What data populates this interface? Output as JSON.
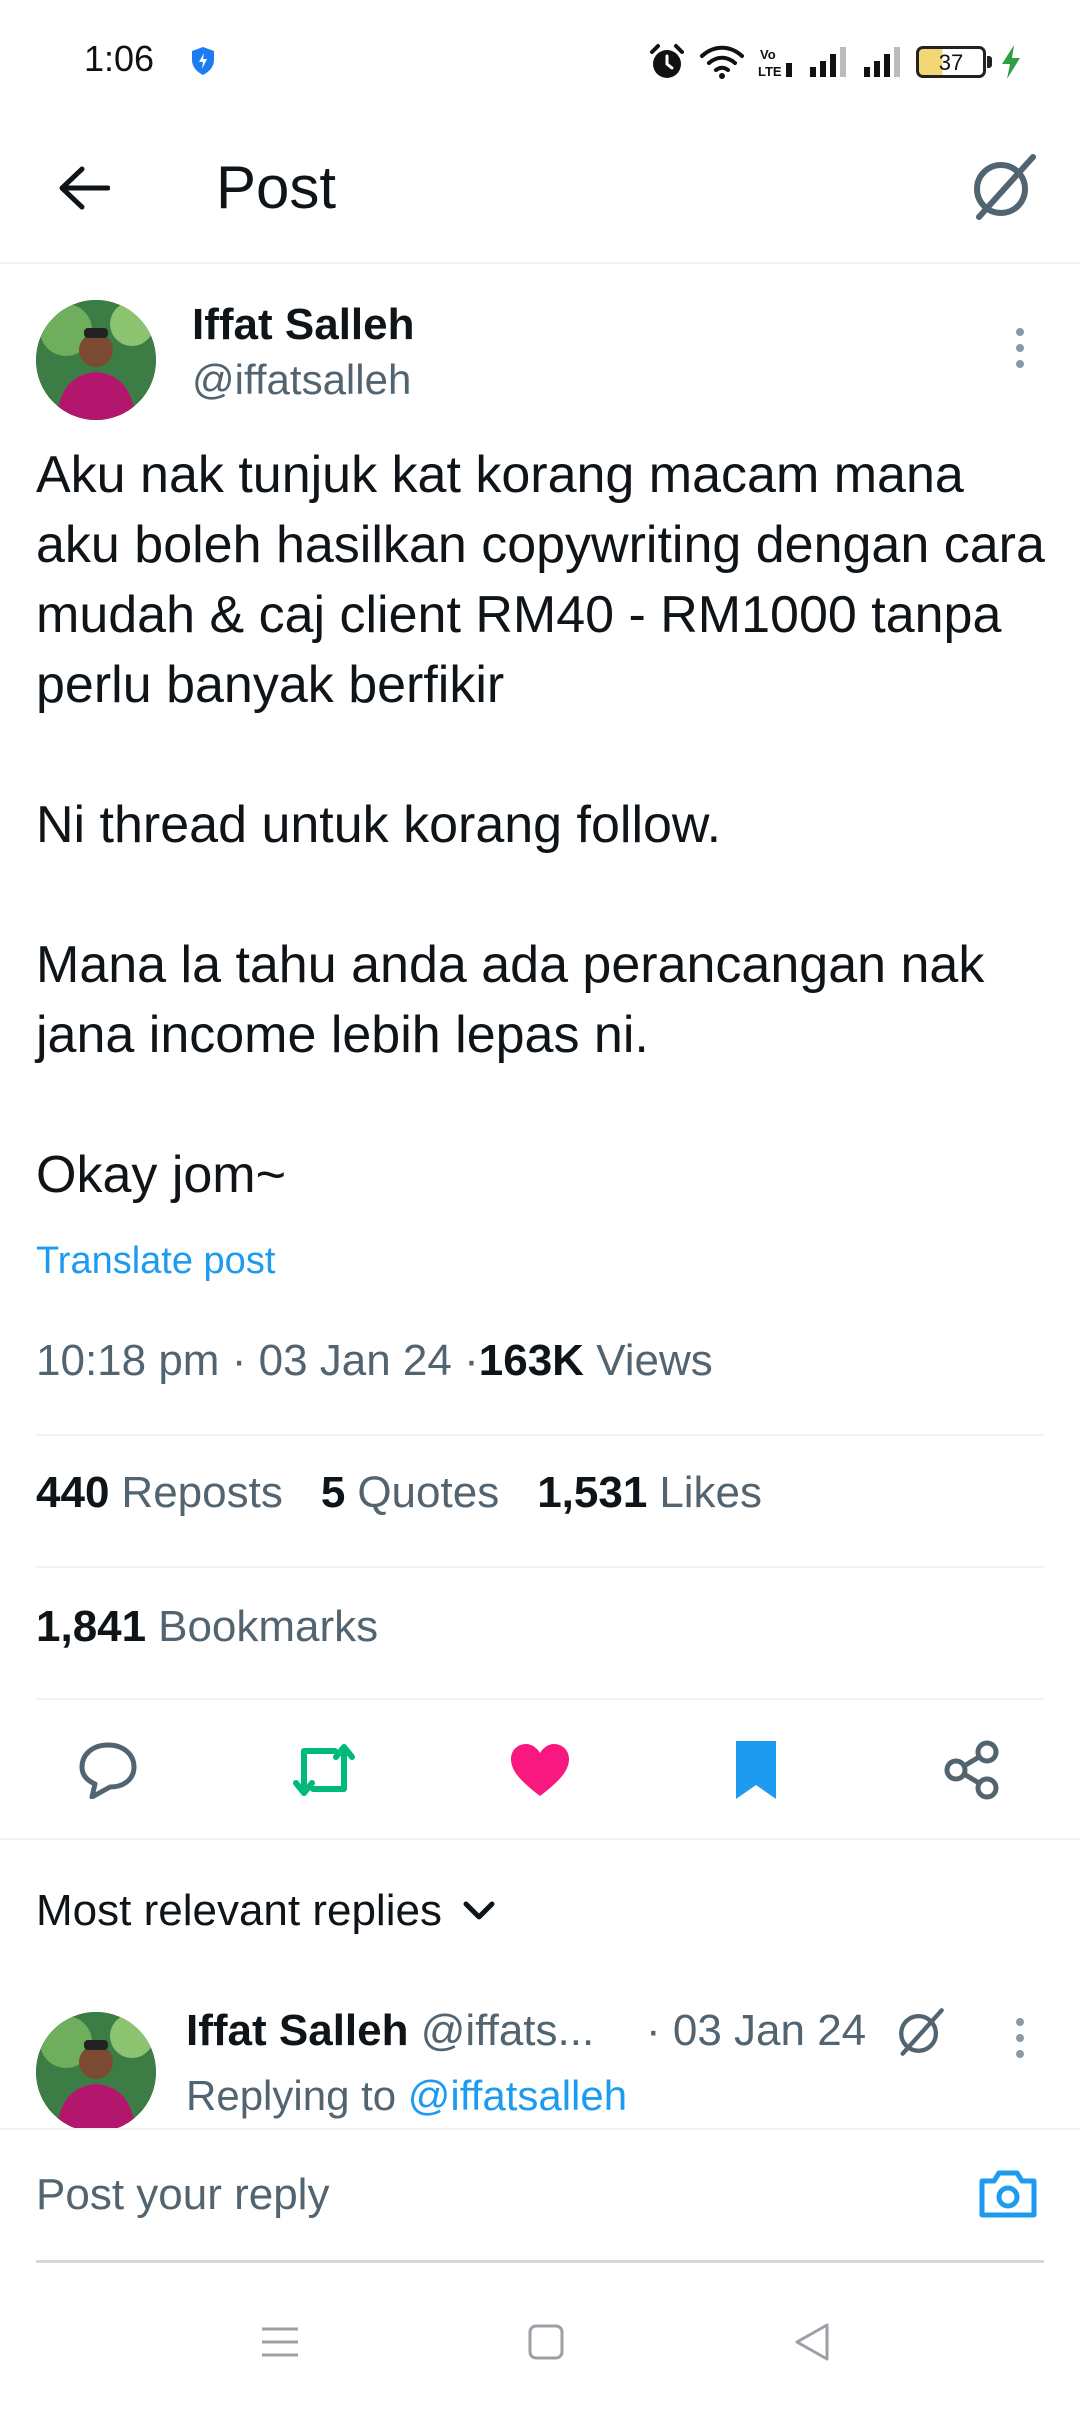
{
  "status_bar": {
    "time": "1:06",
    "battery_level": "37",
    "icons": [
      "shield-icon",
      "alarm-icon",
      "wifi-icon",
      "volte-icon",
      "signal-icon",
      "signal-icon",
      "battery-icon",
      "charging-icon"
    ]
  },
  "header": {
    "title": "Post",
    "back_icon": "arrow-left-icon",
    "grok_icon": "grok-icon"
  },
  "post": {
    "author_name": "Iffat Salleh",
    "author_handle": "@iffatsalleh",
    "paragraphs": [
      "Aku nak tunjuk kat korang macam mana aku boleh hasilkan copywriting dengan cara mudah & caj client RM40 - RM1000 tanpa perlu banyak berfikir",
      "Ni thread untuk korang follow.",
      "Mana la tahu anda ada perancangan nak jana income lebih lepas ni.",
      "Okay jom~"
    ],
    "translate_label": "Translate post",
    "time": "10:18 pm",
    "date": "03 Jan 24",
    "views_count": "163K",
    "views_label": "Views",
    "separator": "·"
  },
  "stats": {
    "reposts_count": "440",
    "reposts_label": "Reposts",
    "quotes_count": "5",
    "quotes_label": "Quotes",
    "likes_count": "1,531",
    "likes_label": "Likes",
    "bookmarks_count": "1,841",
    "bookmarks_label": "Bookmarks"
  },
  "actions": {
    "reply_icon": "reply-icon",
    "repost_icon": "repost-icon",
    "like_icon": "heart-icon",
    "bookmark_icon": "bookmark-icon",
    "share_icon": "share-icon"
  },
  "colors": {
    "accent": "#1d9bf0",
    "repost": "#00ba7c",
    "like": "#f91880",
    "secondary_text": "#536471",
    "primary_text": "#0f1419"
  },
  "replies": {
    "sort_label": "Most relevant replies",
    "items": [
      {
        "name": "Iffat Salleh",
        "handle": "@iffats...",
        "date": "· 03 Jan 24",
        "replying_prefix": "Replying to",
        "replying_handle": "@iffatsalleh"
      }
    ]
  },
  "composer": {
    "placeholder": "Post your reply"
  },
  "nav": {
    "menu_icon": "menu-icon",
    "home_icon": "square-icon",
    "back_icon": "triangle-back-icon"
  }
}
